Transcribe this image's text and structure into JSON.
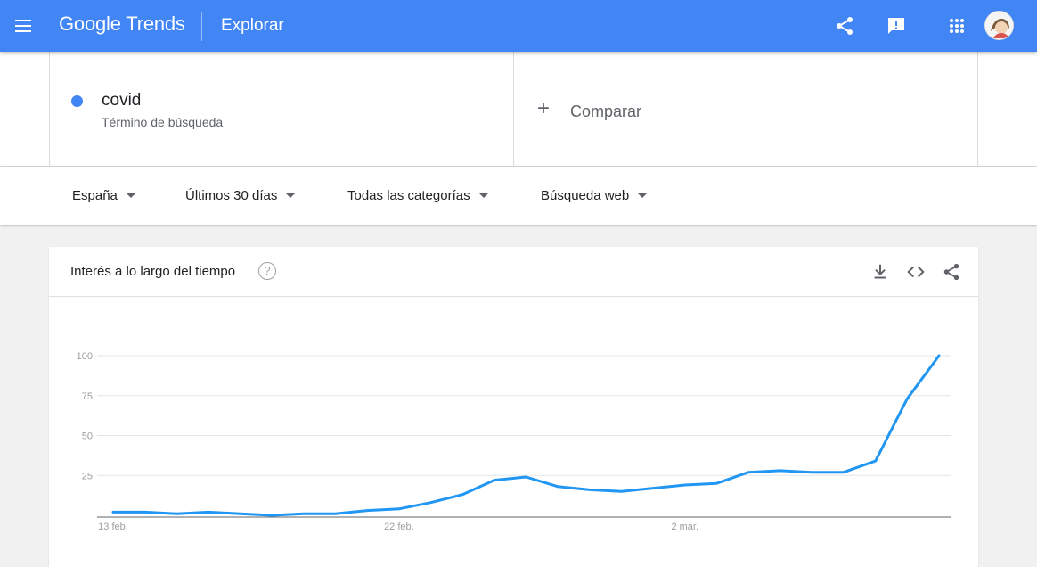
{
  "header": {
    "logo_google": "Google",
    "logo_trends": "Trends",
    "page_title": "Explorar"
  },
  "search": {
    "term": "covid",
    "term_type": "Término de búsqueda",
    "term_color": "#4285f4",
    "compare_label": "Comparar"
  },
  "filters": {
    "region": "España",
    "time_range": "Últimos 30 días",
    "category": "Todas las categorías",
    "search_type": "Búsqueda web"
  },
  "card": {
    "title": "Interés a lo largo del tiempo",
    "help_symbol": "?"
  },
  "chart_data": {
    "type": "line",
    "title": "",
    "xlabel": "",
    "ylabel": "",
    "ylim": [
      0,
      100
    ],
    "y_ticks": [
      "100",
      "75",
      "50",
      "25"
    ],
    "x_ticks": [
      {
        "index": 0,
        "label": "13 feb."
      },
      {
        "index": 9,
        "label": "22 feb."
      },
      {
        "index": 18,
        "label": "2 mar."
      }
    ],
    "grid": true,
    "series": [
      {
        "color": "#2196f3",
        "values": [
          2,
          2,
          1,
          2,
          1,
          0,
          1,
          1,
          3,
          4,
          8,
          13,
          22,
          24,
          18,
          16,
          15,
          17,
          19,
          20,
          27,
          28,
          27,
          27,
          34,
          73,
          100
        ]
      }
    ]
  }
}
